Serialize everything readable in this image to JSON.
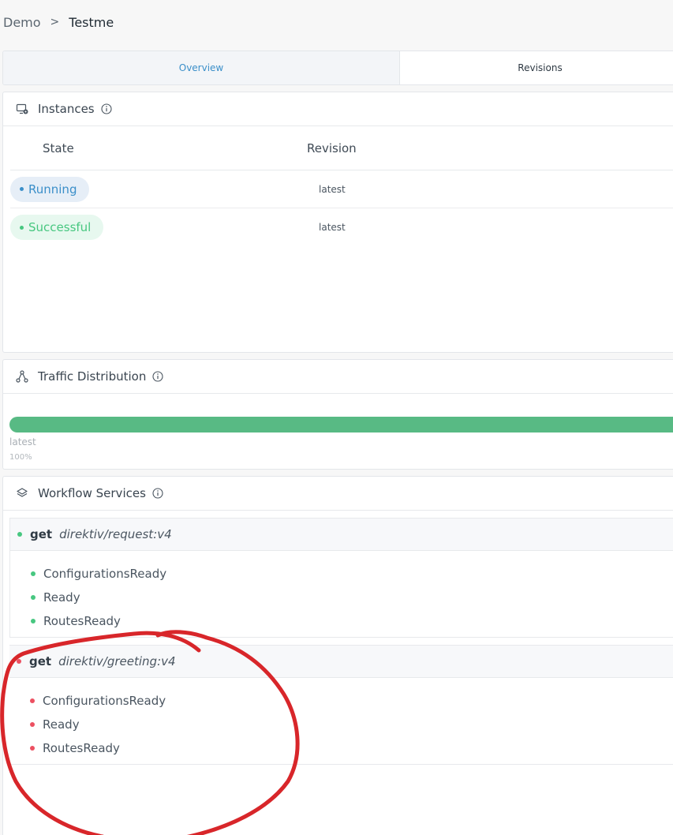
{
  "breadcrumb": {
    "parent": "Demo",
    "separator": ">",
    "current": "Testme"
  },
  "tabs": [
    {
      "label": "Overview",
      "active": true
    },
    {
      "label": "Revisions",
      "active": false
    }
  ],
  "instances": {
    "title": "Instances",
    "columns": {
      "state": "State",
      "revision": "Revision"
    },
    "rows": [
      {
        "state": "Running",
        "revision": "latest"
      },
      {
        "state": "Successful",
        "revision": "latest"
      }
    ]
  },
  "traffic": {
    "title": "Traffic Distribution",
    "revision_label": "latest",
    "percent_label": "100%",
    "fill_fraction": 1.0,
    "color": "#58ba84"
  },
  "services": {
    "title": "Workflow Services",
    "items": [
      {
        "method": "get",
        "image": "direktiv/request:v4",
        "status_color": "#47c780",
        "conditions": [
          "ConfigurationsReady",
          "Ready",
          "RoutesReady"
        ]
      },
      {
        "method": "get",
        "image": "direktiv/greeting:v4",
        "status_color": "#ec5061",
        "conditions": [
          "ConfigurationsReady",
          "Ready",
          "RoutesReady"
        ]
      }
    ]
  },
  "colors": {
    "accent": "#3b8fc9",
    "success": "#47c780",
    "error": "#ec5061",
    "annotation": "#d8262a"
  },
  "icons": [
    "instances-icon",
    "info-icon",
    "traffic-icon",
    "layers-icon"
  ]
}
